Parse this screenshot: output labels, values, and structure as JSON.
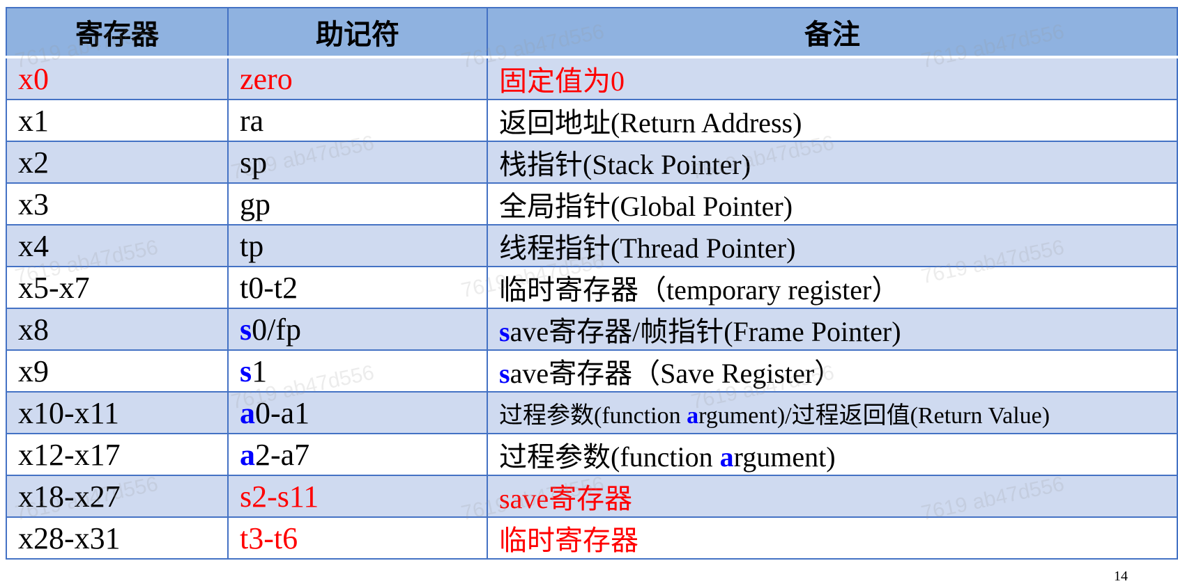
{
  "header": {
    "register": "寄存器",
    "mnemonic": "助记符",
    "note": "备注"
  },
  "rows": [
    {
      "reg": "x0",
      "mnem": [
        {
          "t": "zero"
        }
      ],
      "note": [
        {
          "t": "固定值为0"
        }
      ],
      "red": true
    },
    {
      "reg": "x1",
      "mnem": [
        {
          "t": "ra"
        }
      ],
      "note": [
        {
          "t": "返回地址(Return Address)"
        }
      ]
    },
    {
      "reg": "x2",
      "mnem": [
        {
          "t": "sp"
        }
      ],
      "note": [
        {
          "t": "栈指针(Stack Pointer)"
        }
      ]
    },
    {
      "reg": "x3",
      "mnem": [
        {
          "t": "gp"
        }
      ],
      "note": [
        {
          "t": "全局指针(Global Pointer)"
        }
      ]
    },
    {
      "reg": "x4",
      "mnem": [
        {
          "t": "tp"
        }
      ],
      "note": [
        {
          "t": "线程指针(Thread Pointer)"
        }
      ]
    },
    {
      "reg": "x5-x7",
      "mnem": [
        {
          "t": "t0-t2"
        }
      ],
      "note": [
        {
          "t": "临时寄存器（temporary register）"
        }
      ]
    },
    {
      "reg": "x8",
      "mnem": [
        {
          "t": "s",
          "hl": true
        },
        {
          "t": "0/fp"
        }
      ],
      "note": [
        {
          "t": "s",
          "hl": true
        },
        {
          "t": "ave寄存器/帧指针(Frame Pointer)"
        }
      ]
    },
    {
      "reg": "x9",
      "mnem": [
        {
          "t": "s",
          "hl": true
        },
        {
          "t": "1"
        }
      ],
      "note": [
        {
          "t": "s",
          "hl": true
        },
        {
          "t": "ave寄存器（Save Register）"
        }
      ]
    },
    {
      "reg": "x10-x11",
      "mnem": [
        {
          "t": "a",
          "hl": true
        },
        {
          "t": "0-a1"
        }
      ],
      "note": [
        {
          "t": "过程参数(function "
        },
        {
          "t": "a",
          "hl": true
        },
        {
          "t": "rgument)/过程返回值(Return Value)"
        }
      ],
      "small": true
    },
    {
      "reg": "x12-x17",
      "mnem": [
        {
          "t": "a",
          "hl": true
        },
        {
          "t": "2-a7"
        }
      ],
      "note": [
        {
          "t": "过程参数(function "
        },
        {
          "t": "a",
          "hl": true
        },
        {
          "t": "rgument)"
        }
      ]
    },
    {
      "reg": "x18-x27",
      "mnem": [
        {
          "t": "s2-s11"
        }
      ],
      "note": [
        {
          "t": "save寄存器"
        }
      ],
      "red_right": true
    },
    {
      "reg": "x28-x31",
      "mnem": [
        {
          "t": "t3-t6"
        }
      ],
      "note": [
        {
          "t": "临时寄存器"
        }
      ],
      "red_right": true
    }
  ],
  "watermark": "7619 ab47d556",
  "page_number": "14"
}
